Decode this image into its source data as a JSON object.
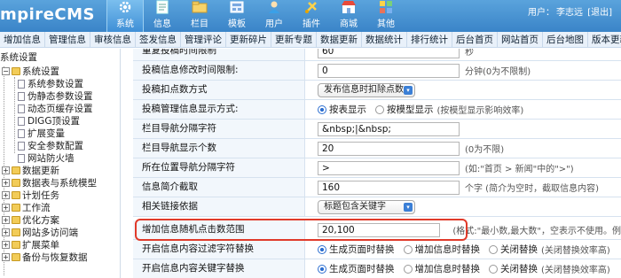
{
  "header": {
    "logo": "mpireCMS",
    "nav": [
      {
        "label": "系统",
        "icon": "gear-icon",
        "active": true
      },
      {
        "label": "信息",
        "icon": "doc-icon"
      },
      {
        "label": "栏目",
        "icon": "folder-icon"
      },
      {
        "label": "模板",
        "icon": "template-icon"
      },
      {
        "label": "用户",
        "icon": "user-icon"
      },
      {
        "label": "插件",
        "icon": "plugin-icon"
      },
      {
        "label": "商城",
        "icon": "shop-icon"
      },
      {
        "label": "其他",
        "icon": "more-icon"
      }
    ],
    "user_label": "用户：",
    "user_name": "李志远",
    "logout": "[退出]"
  },
  "submenu": [
    "增加信息",
    "管理信息",
    "审核信息",
    "签发信息",
    "管理评论",
    "更新碎片",
    "更新专题",
    "数据更新",
    "数据统计",
    "排行统计",
    "后台首页",
    "网站首页",
    "后台地图",
    "版本更新"
  ],
  "tree": {
    "root": "系统设置",
    "sys": "系统设置",
    "children": [
      "系统参数设置",
      "伪静态参数设置",
      "动态页缓存设置",
      "DIGG顶设置",
      "扩展变量",
      "安全参数配置",
      "网站防火墙"
    ],
    "groups": [
      "数据更新",
      "数据表与系统模型",
      "计划任务",
      "工作流",
      "优化方案",
      "网站多访问端",
      "扩展菜单",
      "备份与恢复数据"
    ]
  },
  "form": {
    "r0": {
      "label": "重复投稿时间限制",
      "value": "60",
      "hint": "秒"
    },
    "r1": {
      "label": "投稿信息修改时间限制:",
      "value": "0",
      "hint": "分钟(0为不限制)"
    },
    "r2": {
      "label": "投稿扣点数方式",
      "select": "发布信息时扣除点数"
    },
    "r3": {
      "label": "投稿管理信息显示方式:",
      "opt1": "按表显示",
      "opt2": "按模型显示",
      "hint": "(按模型显示影响效率)"
    },
    "r4": {
      "label": "栏目导航分隔字符",
      "value": "&nbsp;|&nbsp;"
    },
    "r5": {
      "label": "栏目导航显示个数",
      "value": "20",
      "hint": "(0为不限)"
    },
    "r6": {
      "label": "所在位置导航分隔字符",
      "value": ">",
      "hint": "(如:\"首页 > 新闻\"中的\">\")"
    },
    "r7": {
      "label": "信息简介截取",
      "value": "160",
      "hint": "个字 (简介为空时，截取信息内容)"
    },
    "r8": {
      "label": "相关链接依据",
      "select": "标题包含关键字"
    },
    "r9": {
      "label": "增加信息随机点击数范围",
      "value": "20,100",
      "hint": "(格式:\"最小数,最大数\"，空表示不使用。例"
    },
    "r10": {
      "label": "开启信息内容过滤字符替换",
      "opt1": "生成页面时替换",
      "opt2": "增加信息时替换",
      "opt3": "关闭替换",
      "hint": "(关闭替换效率高)"
    },
    "r11": {
      "label": "开启信息内容关键字替换",
      "opt1": "生成页面时替换",
      "opt2": "增加信息时替换",
      "opt3": "关闭替换",
      "hint": "(关闭替换效率高)"
    }
  },
  "colors": {
    "header": "#3a84c8",
    "highlight": "#e03a2a",
    "label_bg": "#f2f7fc"
  }
}
